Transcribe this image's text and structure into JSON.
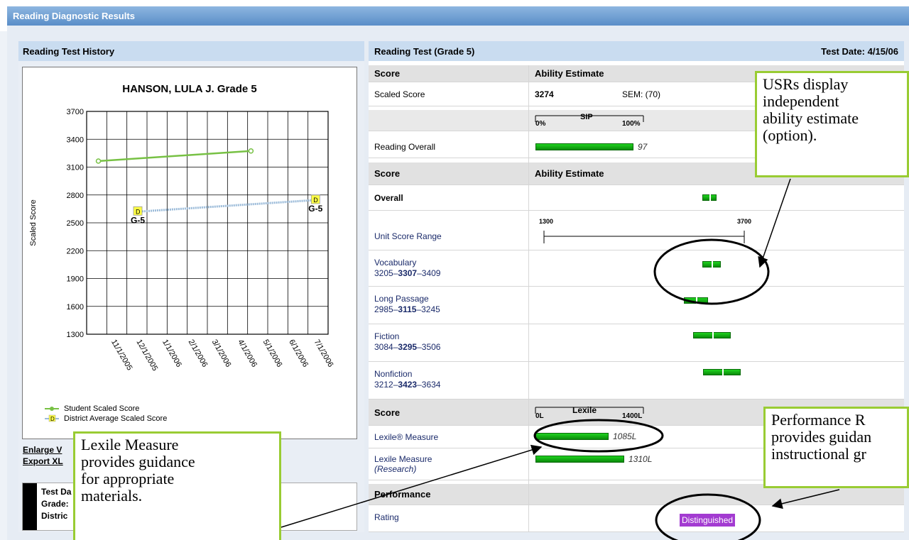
{
  "window": {
    "title": "Reading Diagnostic Results"
  },
  "left_panel": {
    "header": "Reading Test History",
    "chart_title": "HANSON, LULA J. Grade 5",
    "legend": [
      "Student Scaled Score",
      "District Average Scaled Score"
    ],
    "links": [
      "Enlarge V",
      "Export XL"
    ],
    "info_lines": [
      "Test Da",
      "Grade:",
      "Distric"
    ]
  },
  "chart_data": {
    "type": "line",
    "title": "HANSON, LULA J. Grade 5",
    "ylabel": "Scaled Score",
    "xlabel": "",
    "ylim": [
      1300,
      3700
    ],
    "y_ticks": [
      "3700",
      "3400",
      "3100",
      "2800",
      "2500",
      "2200",
      "1900",
      "1600",
      "1300"
    ],
    "x_ticks": [
      "11/1/2005",
      "12/1/2005",
      "1/1/2006",
      "2/1/2006",
      "3/1/2006",
      "4/1/2006",
      "5/1/2006",
      "6/1/2006",
      "7/1/2006"
    ],
    "grid": true,
    "legend_position": "bottom-left",
    "series": [
      {
        "name": "Student Scaled Score",
        "color": "#77c144",
        "x": [
          "10/15/2005",
          "4/15/2006"
        ],
        "y": [
          3165,
          3274
        ]
      },
      {
        "name": "District Average Scaled Score",
        "color": "#9bbbd9",
        "x": [
          "12/1/2005",
          "7/1/2006"
        ],
        "y": [
          2620,
          2745
        ],
        "point_labels": [
          "G-5",
          "G-5"
        ],
        "marker_text": "D"
      }
    ]
  },
  "right_panel": {
    "header": "Reading Test (Grade 5)",
    "test_date": "Test Date: 4/15/06",
    "section1": {
      "col1": "Score",
      "col2": "Ability Estimate"
    },
    "scaled_score": {
      "label": "Scaled Score",
      "value": "3274",
      "sem": "SEM: (70)"
    },
    "sip_scale": {
      "min": "0%",
      "title": "SIP",
      "max": "100%"
    },
    "reading_overall": {
      "label": "Reading Overall",
      "value": "97",
      "fraction": 0.97
    },
    "section2": {
      "col1": "Score",
      "col2": "Ability Estimate"
    },
    "overall": {
      "label": "Overall"
    },
    "unit_score_range": {
      "label": "Unit Score Range",
      "min": "1300",
      "max": "3700"
    },
    "units": [
      {
        "name": "Vocabulary",
        "low": "3205",
        "mid": "3307",
        "high": "3409"
      },
      {
        "name": "Long Passage",
        "low": "2985",
        "mid": "3115",
        "high": "3245"
      },
      {
        "name": "Fiction",
        "low": "3084",
        "mid": "3295",
        "high": "3506"
      },
      {
        "name": "Nonfiction",
        "low": "3212",
        "mid": "3423",
        "high": "3634"
      }
    ],
    "lexile_scale": {
      "col1": "Score",
      "min": "0L",
      "title": "Lexile",
      "max": "1400L"
    },
    "lexile_measure": {
      "label": "Lexile® Measure",
      "value": "1085L",
      "fraction": 0.775
    },
    "lexile_research": {
      "label": "Lexile Measure",
      "sub": "(Research)",
      "value": "1310L",
      "fraction": 0.936
    },
    "performance": {
      "header": "Performance",
      "label": "Rating",
      "value": "Distinguished",
      "color": "#a33bd1"
    }
  },
  "callouts": {
    "usr": "USRs display independent ability estimate (option).",
    "usr_lines": [
      "USRs display",
      "independent",
      "ability estimate",
      "(option)."
    ],
    "performance_lines": [
      "Performance R",
      "provides guidan",
      "instructional gr"
    ],
    "lexile_lines": [
      "Lexile Measure",
      "provides guidance",
      "for appropriate",
      "materials."
    ]
  }
}
